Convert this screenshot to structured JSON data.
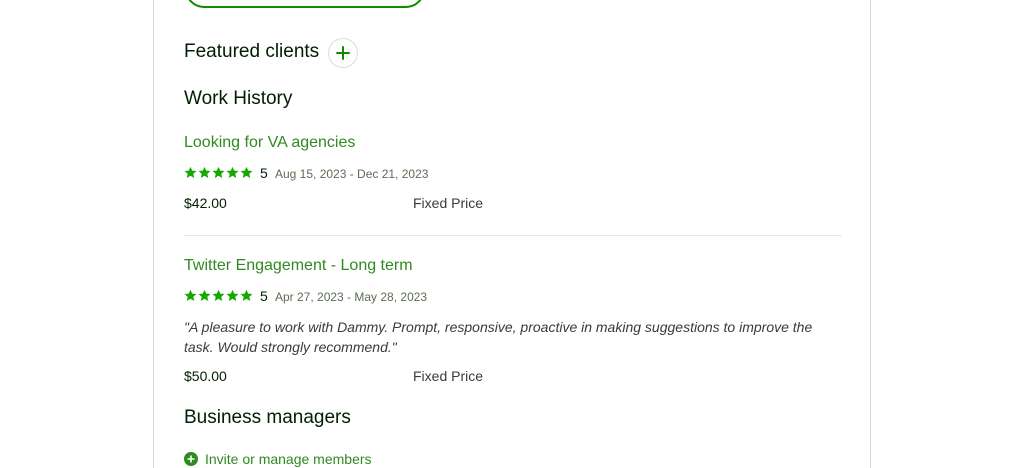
{
  "featured_clients": {
    "title": "Featured clients",
    "add_icon": "plus-icon"
  },
  "work_history": {
    "title": "Work History",
    "jobs": [
      {
        "title": "Looking for VA agencies",
        "rating": "5",
        "stars": 5,
        "dates": "Aug 15, 2023 - Dec 21, 2023",
        "amount": "$42.00",
        "price_type": "Fixed Price"
      },
      {
        "title": "Twitter Engagement - Long term",
        "rating": "5",
        "stars": 5,
        "dates": "Apr 27, 2023 - May 28, 2023",
        "feedback": "\"A pleasure to work with Dammy. Prompt, responsive, proactive in making suggestions to improve the task. Would strongly recommend.\"",
        "amount": "$50.00",
        "price_type": "Fixed Price"
      }
    ]
  },
  "business_managers": {
    "title": "Business managers",
    "invite_label": "Invite or manage members",
    "invite_icon": "add-circle-icon"
  },
  "colors": {
    "accent": "#108a00",
    "link": "#2f8a1f",
    "star": "#14a800"
  }
}
